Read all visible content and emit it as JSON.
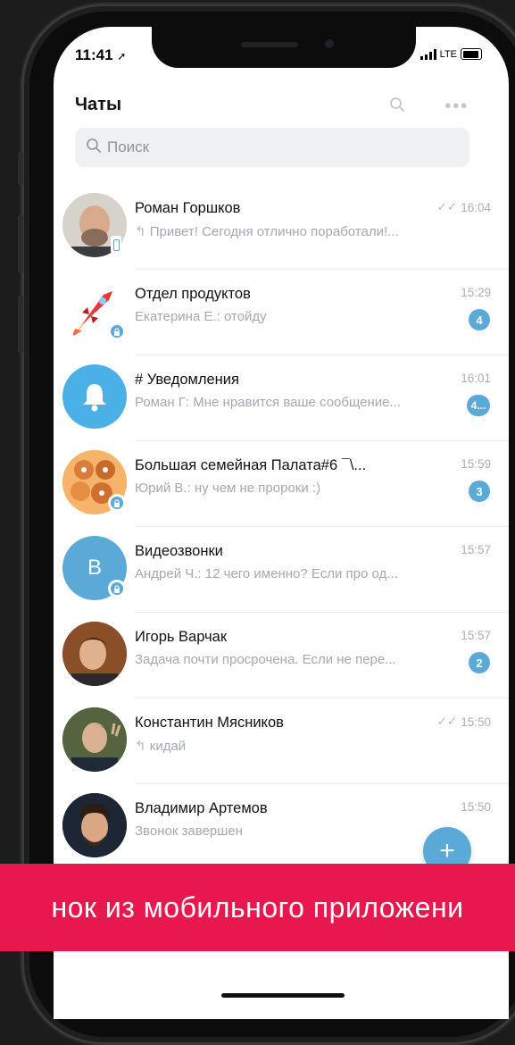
{
  "status_bar": {
    "time": "11:41",
    "network": "LTE"
  },
  "header": {
    "title": "Чаты",
    "search_placeholder": "Поиск"
  },
  "chats": [
    {
      "name": "Роман Горшков",
      "time": "16:04",
      "read": true,
      "preview": "Привет! Сегодня отлично поработали!...",
      "reply": true,
      "badge": ""
    },
    {
      "name": "Отдел продуктов",
      "time": "15:29",
      "read": false,
      "preview": "Екатерина Е.: отойду",
      "reply": false,
      "badge": "4"
    },
    {
      "name": "# Уведомления",
      "time": "16:01",
      "read": false,
      "preview": "Роман Г: Мне нравится ваше сообщение...",
      "reply": false,
      "badge": "4..."
    },
    {
      "name": "Большая семейная Палата#6  ¯\\...",
      "time": "15:59",
      "read": false,
      "preview": "Юрий В.: ну чем не пророки :)",
      "reply": false,
      "badge": "3"
    },
    {
      "name": "Видеозвонки",
      "time": "15:57",
      "read": false,
      "preview": "Андрей Ч.: 12 чего именно? Если про од...",
      "reply": false,
      "badge": "",
      "avatar_letter": "В"
    },
    {
      "name": "Игорь Варчак",
      "time": "15:57",
      "read": false,
      "preview": "Задача почти просрочена. Если не пере...",
      "reply": false,
      "badge": "2"
    },
    {
      "name": "Константин Мясников",
      "time": "15:50",
      "read": true,
      "preview": "кидай",
      "reply": true,
      "badge": ""
    },
    {
      "name": "Владимир Артемов",
      "time": "15:50",
      "read": false,
      "preview": "Звонок завершен",
      "reply": false,
      "badge": ""
    }
  ],
  "fab": {
    "label": "+"
  },
  "banner": {
    "text": "нок из мобильного приложени"
  },
  "colors": {
    "accent": "#5aa9d6",
    "banner": "#e8174e"
  }
}
